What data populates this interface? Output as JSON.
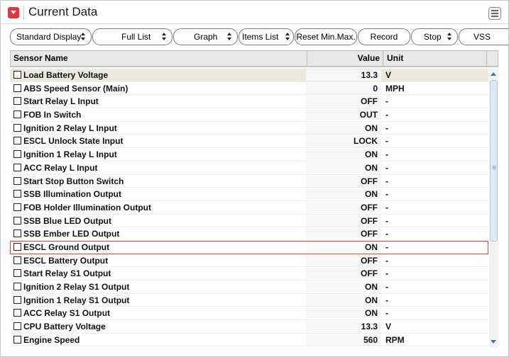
{
  "window": {
    "title": "Current Data"
  },
  "toolbar": {
    "standard_display": "Standard Display",
    "full_list": "Full List",
    "graph": "Graph",
    "items_list": "Items List",
    "reset_min_max": "Reset Min.Max.",
    "record": "Record",
    "stop": "Stop",
    "vss": "VSS"
  },
  "table": {
    "headers": {
      "name": "Sensor Name",
      "value": "Value",
      "unit": "Unit"
    },
    "rows": [
      {
        "name": "Load Battery Voltage",
        "value": "13.3",
        "unit": "V"
      },
      {
        "name": "ABS Speed Sensor (Main)",
        "value": "0",
        "unit": "MPH"
      },
      {
        "name": "Start Relay L Input",
        "value": "OFF",
        "unit": "-"
      },
      {
        "name": "FOB In Switch",
        "value": "OUT",
        "unit": "-"
      },
      {
        "name": "Ignition 2 Relay L Input",
        "value": "ON",
        "unit": "-"
      },
      {
        "name": "ESCL Unlock State Input",
        "value": "LOCK",
        "unit": "-"
      },
      {
        "name": "Ignition 1 Relay L Input",
        "value": "ON",
        "unit": "-"
      },
      {
        "name": "ACC Relay L Input",
        "value": "ON",
        "unit": "-"
      },
      {
        "name": "Start Stop Button Switch",
        "value": "OFF",
        "unit": "-"
      },
      {
        "name": "SSB Illumination Output",
        "value": "ON",
        "unit": "-"
      },
      {
        "name": "FOB Holder Illumination Output",
        "value": "OFF",
        "unit": "-"
      },
      {
        "name": "SSB Blue LED Output",
        "value": "OFF",
        "unit": "-"
      },
      {
        "name": "SSB Ember LED Output",
        "value": "OFF",
        "unit": "-"
      },
      {
        "name": "ESCL Ground Output",
        "value": "ON",
        "unit": "-"
      },
      {
        "name": "ESCL Battery Output",
        "value": "OFF",
        "unit": "-"
      },
      {
        "name": "Start Relay S1 Output",
        "value": "OFF",
        "unit": "-"
      },
      {
        "name": "Ignition 2 Relay S1 Output",
        "value": "ON",
        "unit": "-"
      },
      {
        "name": "Ignition 1 Relay S1 Output",
        "value": "ON",
        "unit": "-"
      },
      {
        "name": "ACC Relay S1 Output",
        "value": "ON",
        "unit": "-"
      },
      {
        "name": "CPU Battery Voltage",
        "value": "13.3",
        "unit": "V"
      },
      {
        "name": "Engine Speed",
        "value": "560",
        "unit": "RPM"
      }
    ]
  },
  "colors": {
    "accent": "#e0383c",
    "selection": "#e24444",
    "header_bg": "#e8e8e8",
    "first_row_bg": "#ece9dd"
  },
  "icons": {
    "app": "dropdown-arrow-icon",
    "menu": "menu-icon"
  }
}
